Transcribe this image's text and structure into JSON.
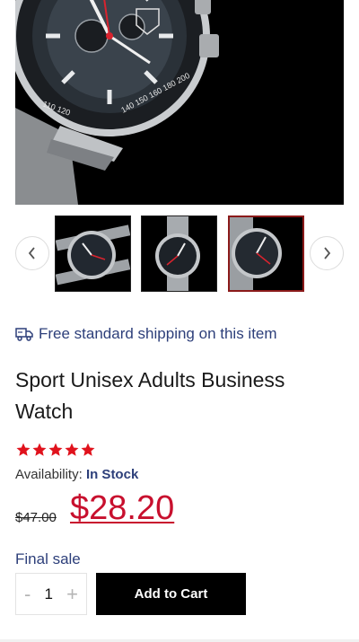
{
  "gallery": {
    "main_image_alt": "watch-main-photo",
    "prev_icon": "chevron-left-icon",
    "next_icon": "chevron-right-icon",
    "thumbnails": [
      "watch-thumbnail-1",
      "watch-thumbnail-2",
      "watch-thumbnail-3"
    ],
    "selected_thumbnail": 3
  },
  "shipping": {
    "icon": "truck-icon",
    "text": "Free standard shipping on this item"
  },
  "product": {
    "title": "Sport Unisex Adults Business Watch",
    "rating": 5,
    "rating_max": 5,
    "availability_label": "Availability:",
    "availability_value": "In Stock",
    "old_price": "$47.00",
    "price": "$28.20",
    "final_sale": "Final sale"
  },
  "cart": {
    "quantity": "1",
    "minus": "-",
    "plus": "+",
    "add_label": "Add to Cart"
  },
  "colors": {
    "accent": "#c8102e",
    "link": "#2d3f7a",
    "button": "#000000",
    "star": "#e0121c"
  }
}
